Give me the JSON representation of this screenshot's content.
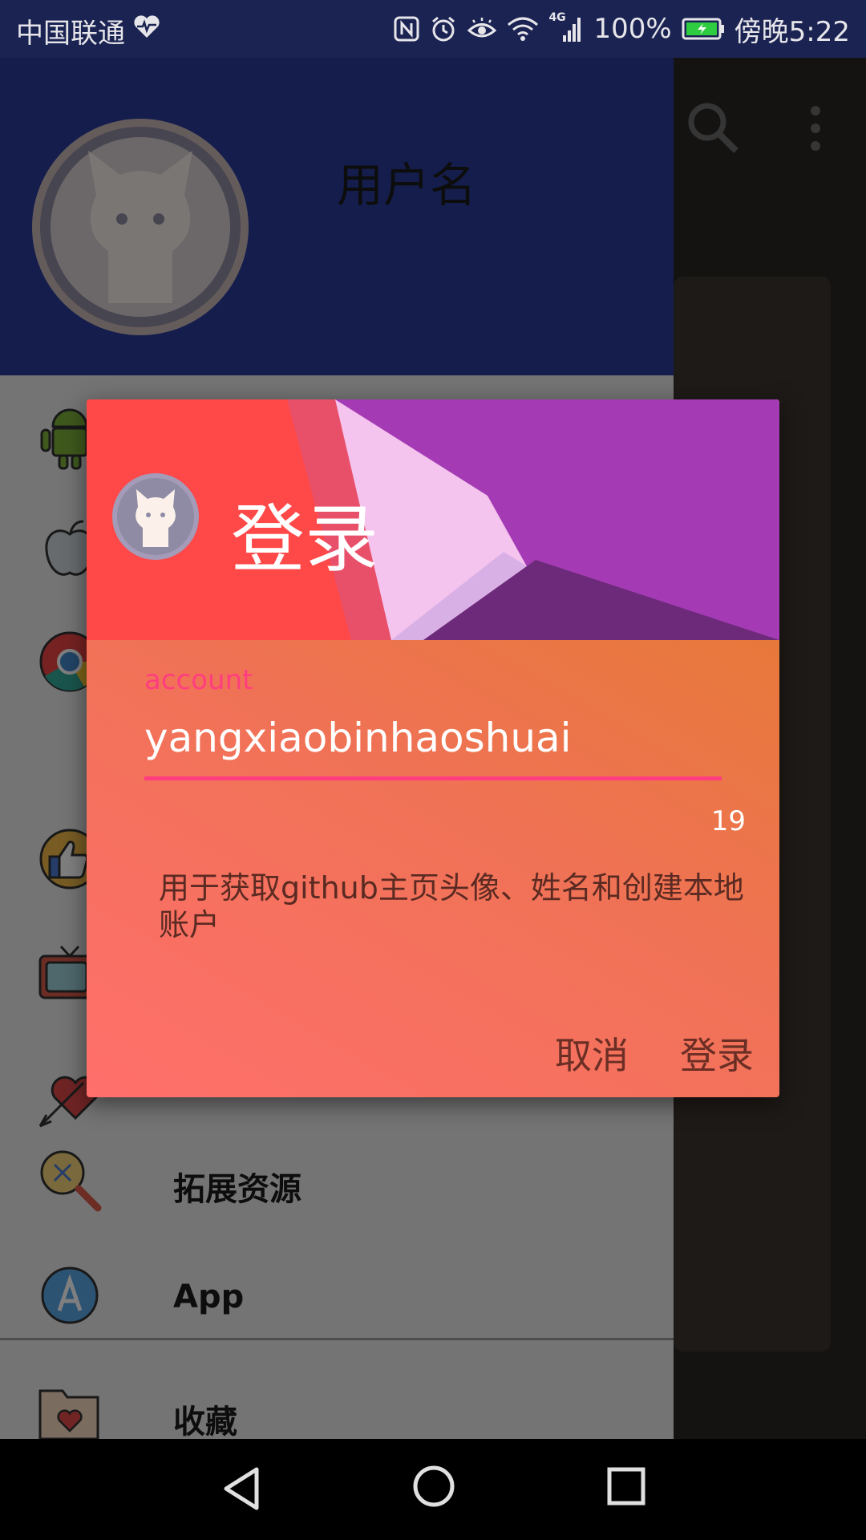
{
  "status_bar": {
    "carrier": "中国联通",
    "network": "4G",
    "battery": "100%",
    "time": "傍晚5:22"
  },
  "drawer": {
    "header": {
      "username": "用户名"
    },
    "items": [
      {
        "icon": "android-icon",
        "label": ""
      },
      {
        "icon": "apple-icon",
        "label": ""
      },
      {
        "icon": "chrome-icon",
        "label": ""
      },
      {
        "icon": "thumbs-up-icon",
        "label": ""
      },
      {
        "icon": "tv-icon",
        "label": ""
      },
      {
        "icon": "heart-arrow-icon",
        "label": ""
      },
      {
        "icon": "search-resource-icon",
        "label": "拓展资源"
      },
      {
        "icon": "app-store-icon",
        "label": "App"
      },
      {
        "icon": "favorites-folder-icon",
        "label": "收藏"
      }
    ]
  },
  "dialog": {
    "title": "登录",
    "field": {
      "label": "account",
      "value": "yangxiaobinhaoshuai",
      "counter": "19"
    },
    "description": "用于获取github主页头像、姓名和创建本地账户",
    "buttons": {
      "cancel": "取消",
      "login": "登录"
    }
  },
  "colors": {
    "accent": "#ff3d7f",
    "drawer_header": "#2a3b9a",
    "status_bar": "#1b2352"
  }
}
